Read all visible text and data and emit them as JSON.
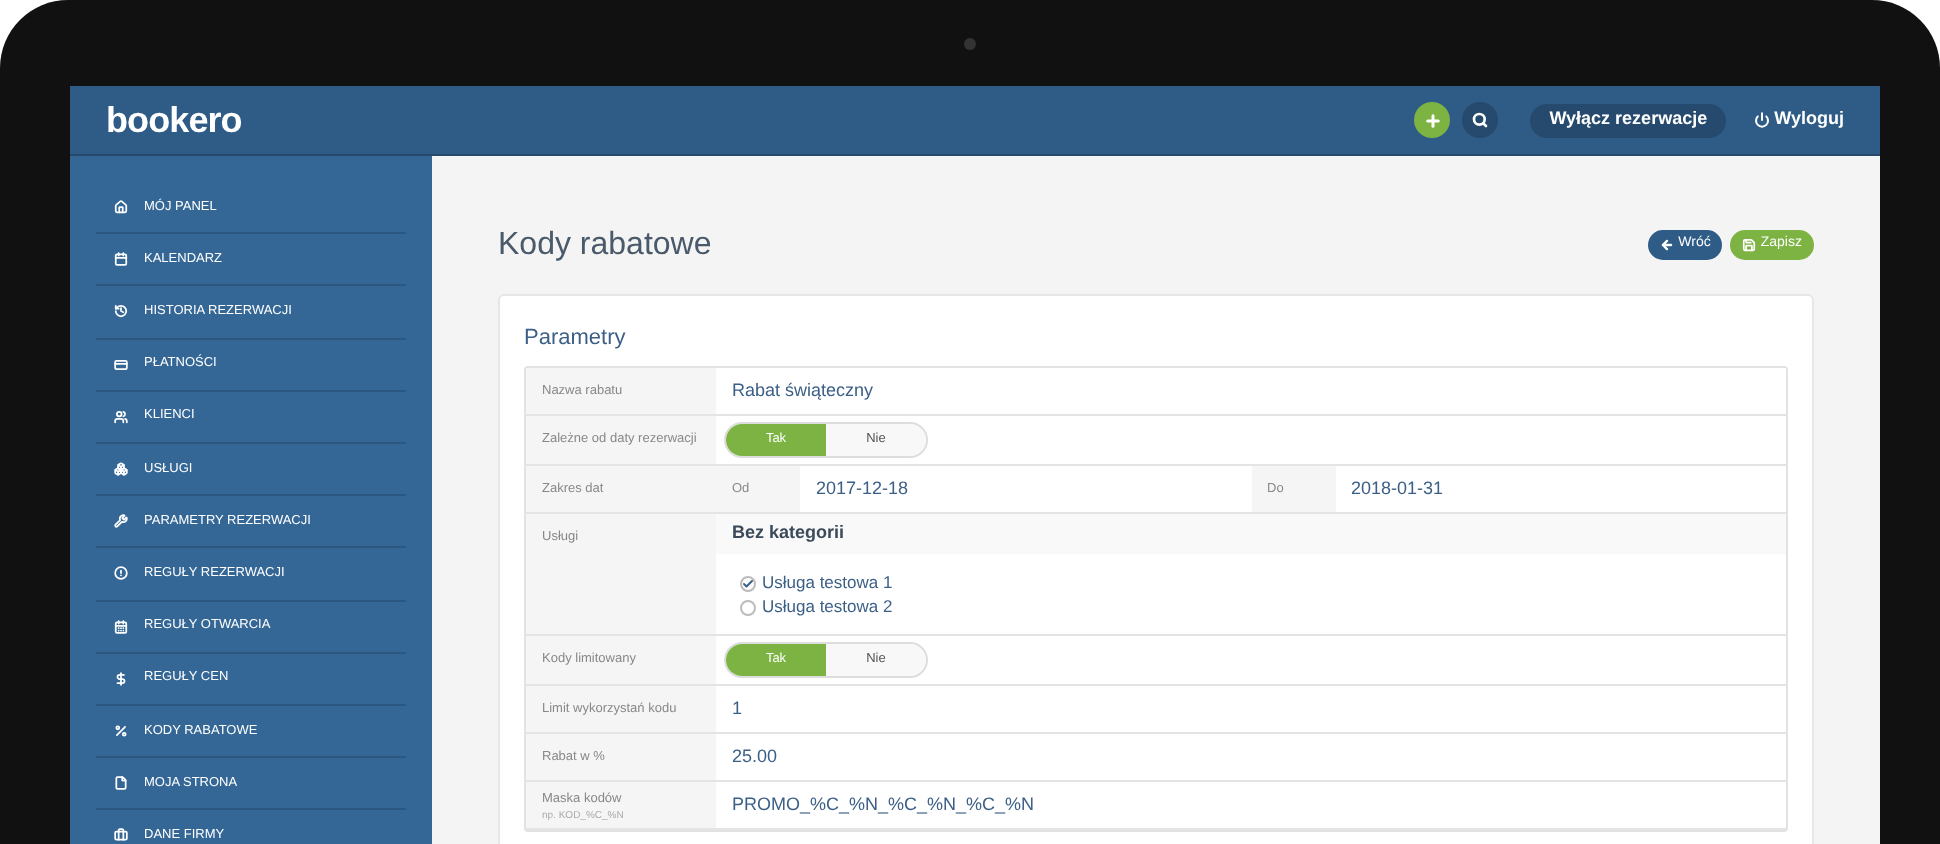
{
  "header": {
    "logo": "bookero",
    "disable_button": "Wyłącz rezerwacje",
    "logout": "Wyloguj"
  },
  "sidebar": {
    "items": [
      {
        "label": "MÓJ PANEL",
        "selected": false
      },
      {
        "label": "KALENDARZ",
        "selected": false
      },
      {
        "label": "HISTORIA REZERWACJI",
        "selected": false
      },
      {
        "label": "PŁATNOŚCI",
        "selected": false
      },
      {
        "label": "KLIENCI",
        "selected": false
      },
      {
        "label": "USŁUGI",
        "selected": false
      },
      {
        "label": "PARAMETRY REZERWACJI",
        "selected": false
      },
      {
        "label": "REGUŁY REZERWACJI",
        "selected": false
      },
      {
        "label": "REGUŁY OTWARCIA",
        "selected": false
      },
      {
        "label": "REGUŁY CEN",
        "selected": false
      },
      {
        "label": "KODY RABATOWE",
        "selected": false
      },
      {
        "label": "MOJA STRONA",
        "selected": false
      },
      {
        "label": "DANE FIRMY",
        "selected": false
      }
    ]
  },
  "page": {
    "title": "Kody rabatowe",
    "back_button": "Wróć",
    "save_button": "Zapisz"
  },
  "form": {
    "section_title": "Parametry",
    "rows": [
      {
        "kind": "text",
        "label": "Nazwa rabatu",
        "value": "Rabat świąteczny"
      },
      {
        "kind": "toggle",
        "label": "Zależne od daty rezerwacji",
        "options": [
          {
            "label": "Tak",
            "selected": true
          },
          {
            "label": "Nie",
            "selected": false
          }
        ]
      },
      {
        "kind": "daterange",
        "label": "Zakres dat",
        "from_label": "Od",
        "from": "2017-12-18",
        "to_label": "Do",
        "to": "2018-01-31"
      },
      {
        "kind": "checklist",
        "label": "Usługi",
        "category": "Bez kategorii",
        "items": [
          {
            "label": "Usługa testowa 1",
            "checked": true
          },
          {
            "label": "Usługa testowa 2",
            "checked": false
          }
        ]
      },
      {
        "kind": "toggle",
        "label": "Kody limitowany",
        "options": [
          {
            "label": "Tak",
            "selected": true
          },
          {
            "label": "Nie",
            "selected": false
          }
        ]
      },
      {
        "kind": "text",
        "label": "Limit wykorzystań kodu",
        "value": "1"
      },
      {
        "kind": "text",
        "label": "Rabat w %",
        "value": "25.00"
      },
      {
        "kind": "text",
        "label": "Maska kodów",
        "hint": "np. KOD_%C_%N",
        "value": "PROMO_%C_%N_%C_%N_%C_%N"
      }
    ]
  }
}
